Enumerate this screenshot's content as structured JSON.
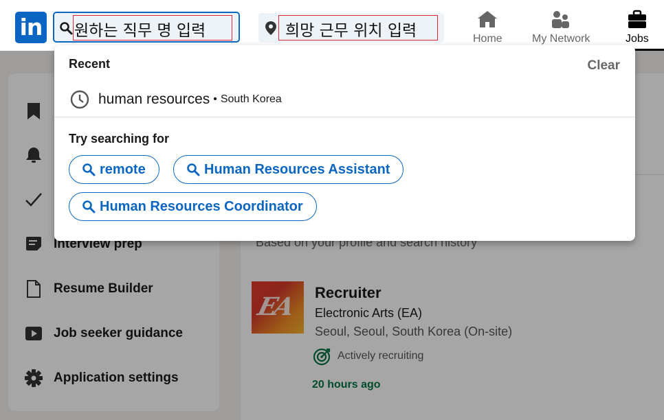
{
  "nav": {
    "logo_text": "in",
    "search": {
      "placeholder": "원하는 직무 명 입력",
      "value": ""
    },
    "location": {
      "placeholder": "희망 근무 위치 입력",
      "value": ""
    },
    "items": [
      {
        "label": "Home",
        "icon": "home-icon",
        "active": false
      },
      {
        "label": "My Network",
        "icon": "my-network-icon",
        "active": false
      },
      {
        "label": "Jobs",
        "icon": "jobs-icon",
        "active": true
      }
    ]
  },
  "dropdown": {
    "recent_title": "Recent",
    "clear_label": "Clear",
    "recent_items": [
      {
        "query": "human resources",
        "separator": "•",
        "location": "South Korea"
      }
    ],
    "try_title": "Try searching for",
    "suggestions": [
      "remote",
      "Human Resources Assistant",
      "Human Resources Coordinator"
    ]
  },
  "sidebar": {
    "items": [
      {
        "label": "",
        "icon": "bookmark-icon"
      },
      {
        "label": "",
        "icon": "bell-icon"
      },
      {
        "label": "",
        "icon": "checkmark-icon"
      },
      {
        "label": "Interview prep",
        "icon": "interview-prep-icon"
      },
      {
        "label": "Resume Builder",
        "icon": "document-icon"
      },
      {
        "label": "Job seeker guidance",
        "icon": "video-icon"
      },
      {
        "label": "Application settings",
        "icon": "gear-icon"
      }
    ]
  },
  "main": {
    "subtitle": "Based on your profile and search history",
    "job": {
      "logo_text": "EA",
      "title": "Recruiter",
      "company": "Electronic Arts (EA)",
      "location": "Seoul, Seoul, South Korea (On-site)",
      "status": "Actively recruiting",
      "posted": "20 hours ago"
    }
  },
  "colors": {
    "brand": "#0a66c2",
    "highlight_outline": "#e0262f",
    "posted_green": "#057642",
    "overlay": "rgba(0,0,0,0.35)"
  }
}
